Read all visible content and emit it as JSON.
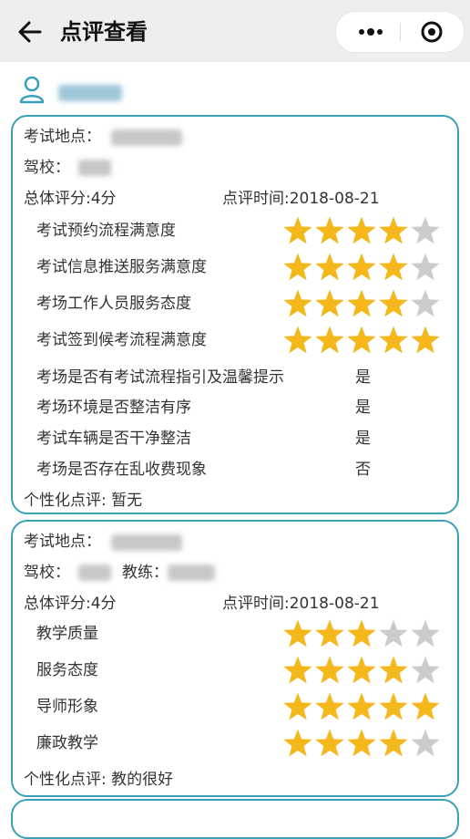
{
  "header": {
    "title": "点评查看"
  },
  "colors": {
    "star_filled": "#f4b71c",
    "star_empty": "#cccccc",
    "card_border": "#3aa0b8"
  },
  "card1": {
    "location_label": "考试地点：",
    "school_label": "驾校：",
    "score_label": "总体评分:4分",
    "time_label": "点评时间:2018-08-21",
    "ratings": [
      {
        "label": "考试预约流程满意度",
        "stars": 4
      },
      {
        "label": "考试信息推送服务满意度",
        "stars": 4
      },
      {
        "label": "考场工作人员服务态度",
        "stars": 4
      },
      {
        "label": "考试签到候考流程满意度",
        "stars": 5
      }
    ],
    "questions": [
      {
        "label": "考场是否有考试流程指引及温馨提示",
        "answer": "是"
      },
      {
        "label": "考场环境是否整洁有序",
        "answer": "是"
      },
      {
        "label": "考试车辆是否干净整洁",
        "answer": "是"
      },
      {
        "label": "考场是否存在乱收费现象",
        "answer": "否"
      }
    ],
    "comment": "个性化点评:  暂无"
  },
  "card2": {
    "location_label": "考试地点：",
    "school_label": "驾校：",
    "coach_label": "教练：",
    "score_label": "总体评分:4分",
    "time_label": "点评时间:2018-08-21",
    "ratings": [
      {
        "label": "教学质量",
        "stars": 3
      },
      {
        "label": "服务态度",
        "stars": 4
      },
      {
        "label": "导师形象",
        "stars": 5
      },
      {
        "label": "廉政教学",
        "stars": 4
      }
    ],
    "comment": "个性化点评:  教的很好"
  }
}
